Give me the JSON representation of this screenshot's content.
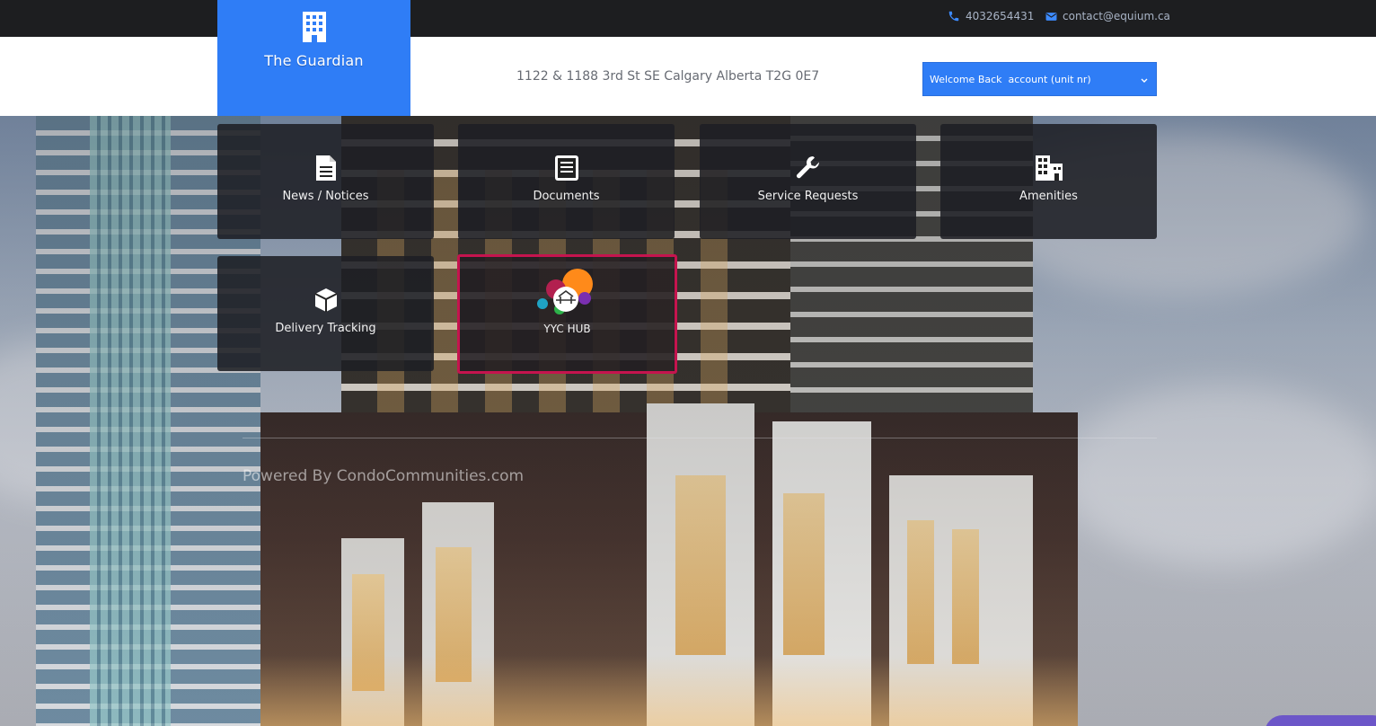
{
  "topbar": {
    "phone": "4032654431",
    "email": "contact@equium.ca"
  },
  "brand": {
    "title": "The Guardian",
    "icon": "building-icon",
    "color": "#2f7df6"
  },
  "header": {
    "address": "1122 & 1188 3rd St SE Calgary Alberta T2G 0E7",
    "account_select": "Welcome Back  account (unit nr)"
  },
  "tiles": [
    {
      "label": "News / Notices",
      "icon": "document-icon"
    },
    {
      "label": "Documents",
      "icon": "list-document-icon"
    },
    {
      "label": "Service Requests",
      "icon": "wrench-icon"
    },
    {
      "label": "Amenities",
      "icon": "buildings-icon"
    },
    {
      "label": "Delivery Tracking",
      "icon": "package-icon"
    },
    {
      "label": "YYC HUB",
      "icon": "yyc-hub-logo",
      "active": true
    }
  ],
  "footer": {
    "powered_by": "Powered By CondoCommunities.com"
  },
  "colors": {
    "accent": "#2f7df6",
    "active_border": "#c5144e",
    "topbar": "#1d1e20"
  }
}
